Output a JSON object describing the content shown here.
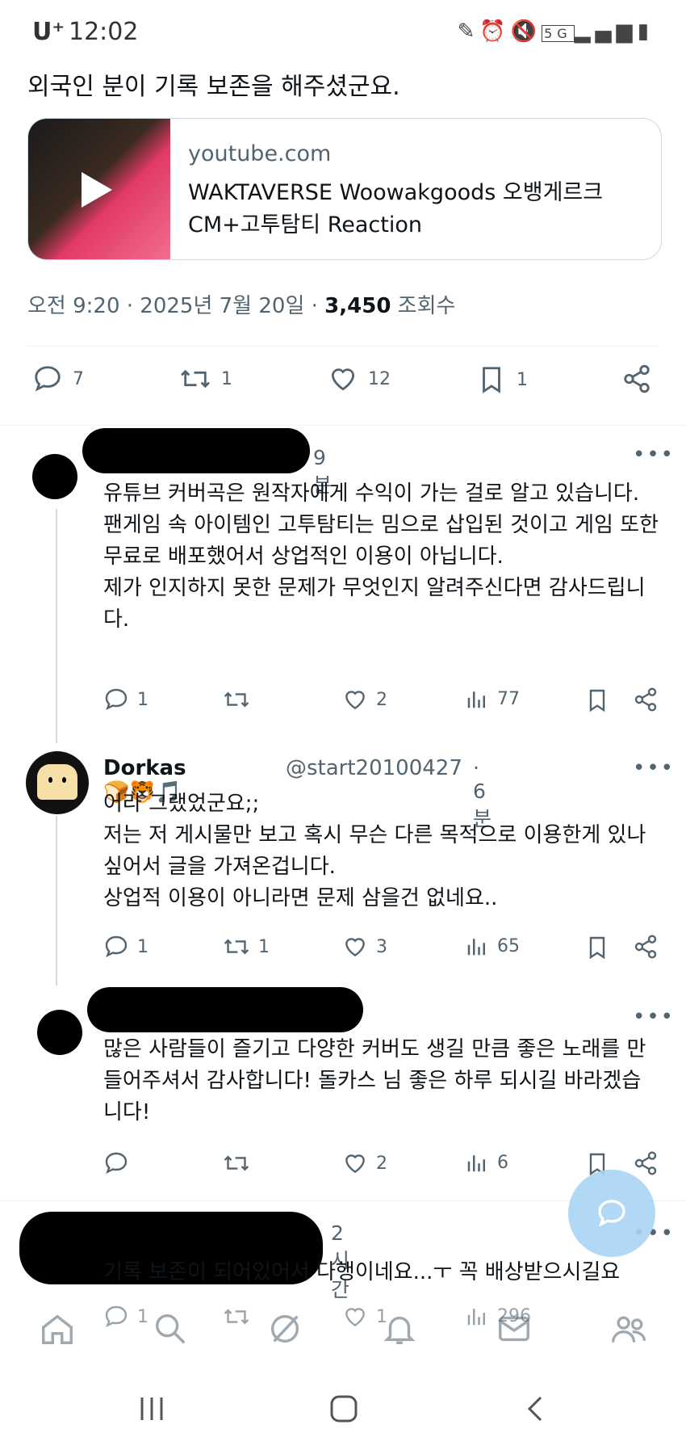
{
  "status_bar": {
    "carrier": "U⁺",
    "time": "12:02",
    "network": "5G"
  },
  "tweet": {
    "text": "외국인 분이 기록 보존을 해주셨군요.",
    "card": {
      "domain": "youtube.com",
      "title": "WAKTAVERSE Woowakgoods 오뱅게르크 CM+고투탐티 Reaction"
    },
    "meta": {
      "time": "오전 9:20 · 2025년 7월 20일 · ",
      "views": "3,450",
      "views_label": " 조회수"
    },
    "counts": {
      "replies": "7",
      "retweets": "1",
      "likes": "12",
      "bookmarks": "1"
    }
  },
  "replies": [
    {
      "time": "9분",
      "text": "유튜브 커버곡은 원작자에게 수익이 가는 걸로 알고 있습니다.\n팬게임 속 아이템인 고투탐티는 밈으로 삽입된 것이고 게임 또한 무료로 배포했어서 상업적인 이용이 아닙니다.\n제가 인지하지 못한 문제가 무엇인지 알려주신다면 감사드립니다.",
      "replies": "1",
      "retweets": "",
      "likes": "2",
      "views": "77"
    },
    {
      "name": "Dorkas🍞🐯🎵",
      "handle": "@start20100427",
      "time": "· 6분",
      "text": "어라 그랬었군요;;\n저는 저 게시물만 보고 혹시 무슨 다른 목적으로 이용한게 있나 싶어서 글을 가져온겁니다.\n상업적 이용이 아니라면 문제 삼을건 없네요..",
      "replies": "1",
      "retweets": "1",
      "likes": "3",
      "views": "65"
    },
    {
      "time": "",
      "text": "많은 사람들이 즐기고 다양한 커버도 생길 만큼 좋은 노래를 만들어주셔서 감사합니다! 돌카스 님 좋은 하루 되시길 바라겠습니다!",
      "replies": "",
      "retweets": "",
      "likes": "2",
      "views": "6"
    },
    {
      "time": "2시간",
      "text": "기록 보존이 되어있어서 다행이네요...ㅜ 꼭 배상받으시길요",
      "replies": "1",
      "retweets": "",
      "likes": "1",
      "views": "296"
    }
  ],
  "colors": {
    "secondary": "#536471",
    "fab": "#a9d4f5",
    "border": "#cfd9de"
  }
}
